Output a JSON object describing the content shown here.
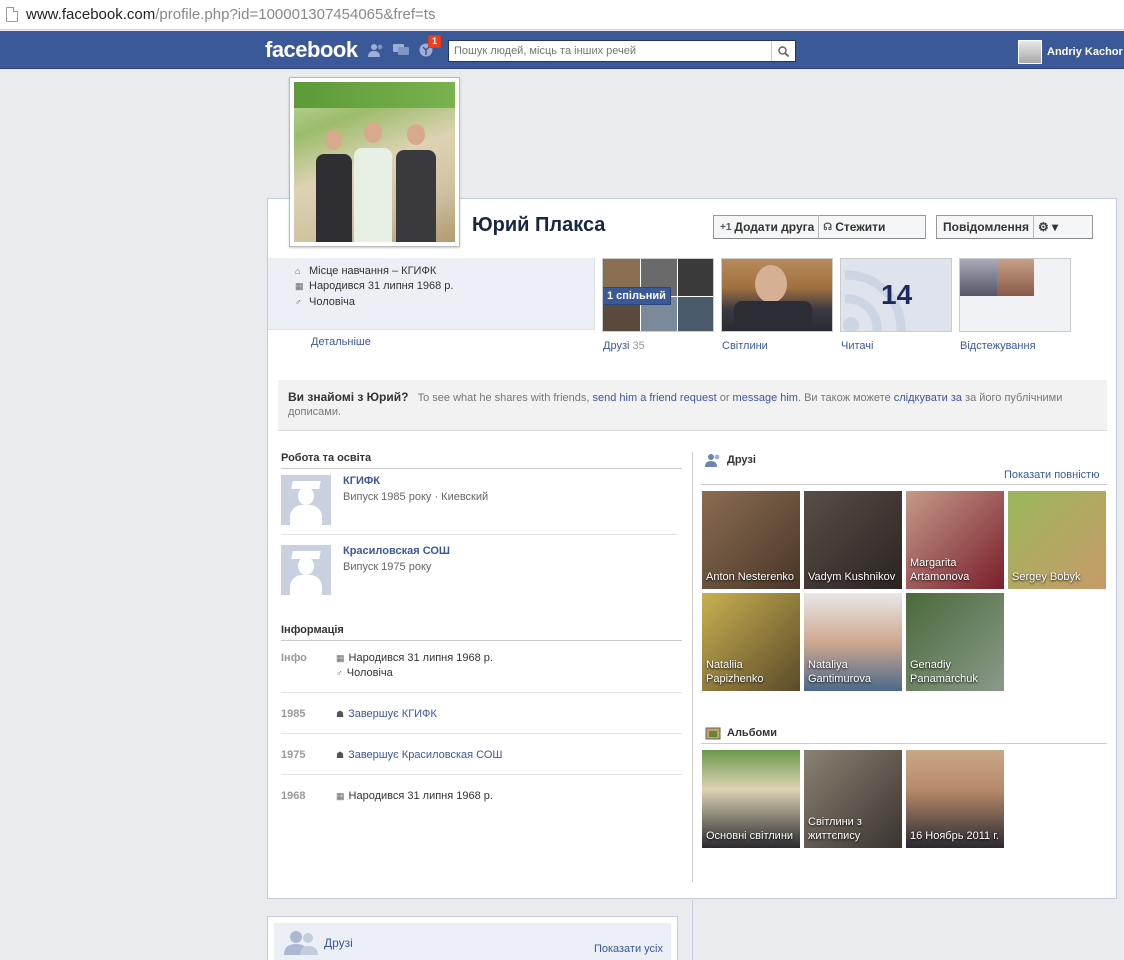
{
  "browser": {
    "url_main": "www.facebook.com",
    "url_rest": "/profile.php?id=100001307454065&fref=ts"
  },
  "header": {
    "logo": "facebook",
    "notifications_count": "1",
    "search_placeholder": "Пошук людей, місць та інших речей",
    "user_name": "Andriy Kachor"
  },
  "profile": {
    "name": "Юрий Плакса",
    "buttons": {
      "add_friend": "Додати друга",
      "follow": "Стежити",
      "message": "Повідомлення"
    },
    "info": {
      "education": "Місце навчання – КГИФК",
      "born": "Народився 31 липня 1968 р.",
      "gender": "Чоловіча"
    },
    "details_link": "Детальніше"
  },
  "tiles": {
    "friends_label": "Друзі",
    "friends_count": "35",
    "mutual_badge": "1 спільний",
    "photos_label": "Світлини",
    "subscribers_label": "Читачі",
    "subscribers_count": "14",
    "following_label": "Відстежування"
  },
  "know_box": {
    "question": "Ви знайомі з Юрий?",
    "text_1": "To see what he shares with friends,",
    "send_request": "send him a friend request",
    "or": "or",
    "message_him": "message him",
    "text_2": ". Ви також можете",
    "follow_link": "слідкувати за",
    "text_3": "за його публічними дописами."
  },
  "work_education": {
    "title": "Робота та освіта",
    "items": [
      {
        "name": "КГИФК",
        "detail": "Випуск 1985 року · Киевский"
      },
      {
        "name": "Красиловская СОШ",
        "detail": "Випуск 1975 року"
      }
    ]
  },
  "information": {
    "title": "Інформація",
    "info_label": "Інфо",
    "born": "Народився 31 липня 1968 р.",
    "gender": "Чоловіча",
    "events": [
      {
        "year": "1985",
        "text": "Завершує КГИФК"
      },
      {
        "year": "1975",
        "text": "Завершує Красиловская СОШ"
      },
      {
        "year": "1968",
        "text": "Народився 31 липня 1968 р."
      }
    ]
  },
  "friends_section": {
    "title": "Друзі",
    "show_all": "Показати повністю",
    "friends": [
      {
        "name": "Anton Nesterenko",
        "color": "#6b4b36"
      },
      {
        "name": "Vadym Kushnikov",
        "color": "#4a3b35"
      },
      {
        "name": "Margarita Artamonova",
        "color": "#8a2a3a"
      },
      {
        "name": "Sergey Bobyk",
        "color": "#6a8a3a"
      },
      {
        "name": "Nataliia Papizhenko",
        "color": "#8a7a3a"
      },
      {
        "name": "Nataliya Gantimurova",
        "color": "#4a6a8a"
      },
      {
        "name": "Genadiy Panamarchuk",
        "color": "#5a6a4a"
      }
    ]
  },
  "albums_section": {
    "title": "Альбоми",
    "albums": [
      {
        "name": "Основні світлини",
        "color": "#7a9a5a"
      },
      {
        "name": "Світлини з життєпису",
        "color": "#6a6258"
      },
      {
        "name": "16 Ноябрь 2011 г.",
        "color": "#5a4a3a"
      }
    ]
  },
  "bottom": {
    "title": "Друзі",
    "show_all": "Показати усіх"
  }
}
